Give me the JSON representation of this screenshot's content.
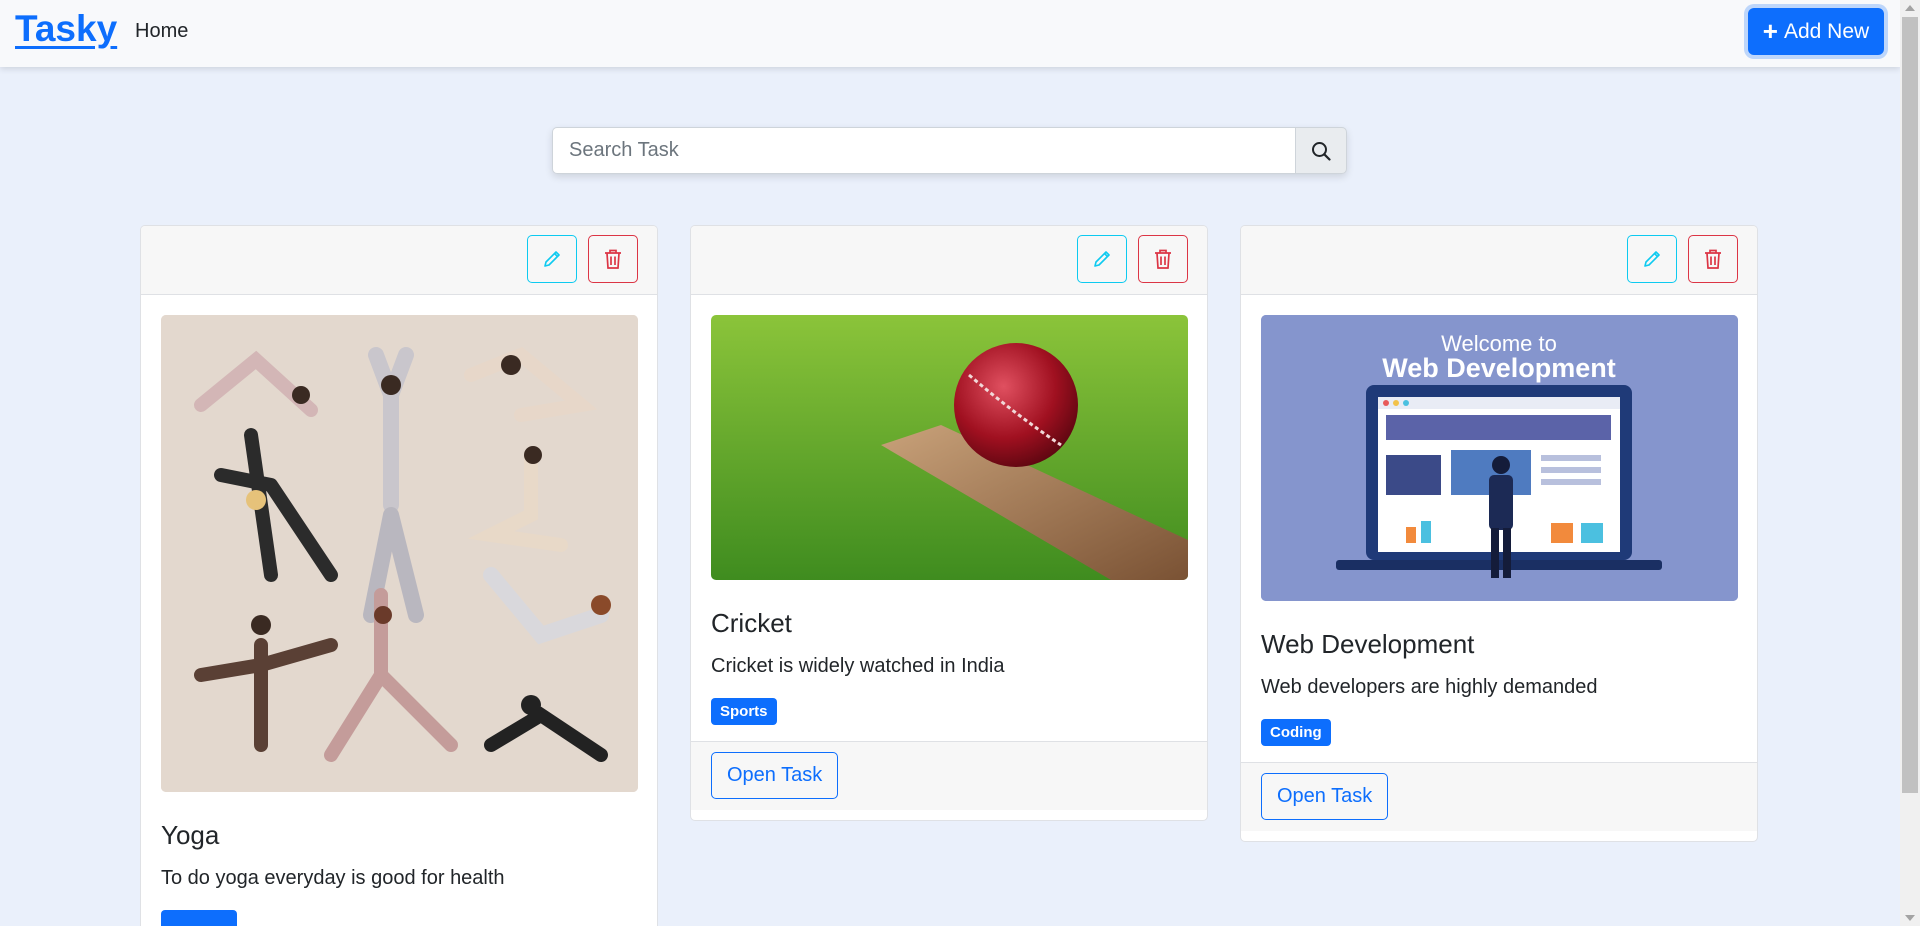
{
  "navbar": {
    "brand": "Tasky",
    "home": "Home",
    "add_new": "Add New"
  },
  "search": {
    "placeholder": "Search Task"
  },
  "cards": [
    {
      "title": "Yoga",
      "description": "To do yoga everyday is good for health",
      "tag": "",
      "image": "yoga-illustration"
    },
    {
      "title": "Cricket",
      "description": "Cricket is widely watched in India",
      "tag": "Sports",
      "image": "cricket-ball-on-bat",
      "open_label": "Open Task"
    },
    {
      "title": "Web Development",
      "description": "Web developers are highly demanded",
      "tag": "Coding",
      "image": "web-development-illustration",
      "image_caption_line1": "Welcome to",
      "image_caption_line2": "Web Development",
      "open_label": "Open Task"
    }
  ],
  "colors": {
    "primary": "#0d6efd",
    "info": "#0dcaf0",
    "danger": "#dc3545",
    "page_bg": "#eaf0fb"
  }
}
